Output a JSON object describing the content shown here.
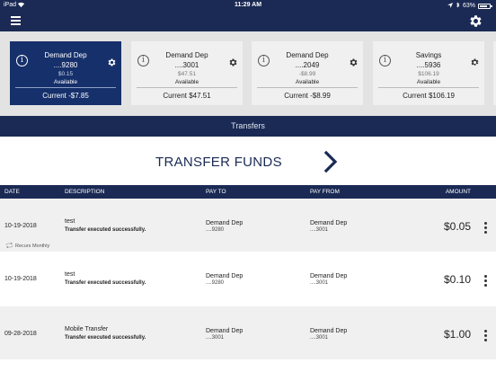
{
  "status_bar": {
    "carrier": "iPad",
    "time": "11:29 AM",
    "battery": "63%",
    "battery_level": 0.63
  },
  "accounts": [
    {
      "title": "Demand Dep",
      "number": "....9280",
      "balance": "$0.15",
      "available_label": "Available",
      "current": "Current -$7.85",
      "selected": true
    },
    {
      "title": "Demand Dep",
      "number": "....3001",
      "balance": "$47.51",
      "available_label": "Available",
      "current": "Current $47.51",
      "selected": false
    },
    {
      "title": "Demand Dep",
      "number": "....2049",
      "balance": "-$8.99",
      "available_label": "Available",
      "current": "Current -$8.99",
      "selected": false
    },
    {
      "title": "Savings",
      "number": "....5936",
      "balance": "$106.19",
      "available_label": "Available",
      "current": "Current $106.19",
      "selected": false
    }
  ],
  "section_title": "Transfers",
  "transfer_funds_label": "TRANSFER FUNDS",
  "table": {
    "headers": {
      "date": "DATE",
      "description": "DESCRIPTION",
      "pay_to": "PAY TO",
      "pay_from": "PAY FROM",
      "amount": "AMOUNT"
    },
    "rows": [
      {
        "date": "10-19-2018",
        "description": "test",
        "status": "Transfer executed successfully.",
        "pay_to": "Demand Dep",
        "pay_to_num": "....9280",
        "pay_from": "Demand Dep",
        "pay_from_num": "....3001",
        "amount": "$0.05",
        "recurs": "Recurs Monthly"
      },
      {
        "date": "10-19-2018",
        "description": "test",
        "status": "Transfer executed successfully.",
        "pay_to": "Demand Dep",
        "pay_to_num": "....9280",
        "pay_from": "Demand Dep",
        "pay_from_num": "....3001",
        "amount": "$0.10",
        "recurs": ""
      },
      {
        "date": "09-28-2018",
        "description": "Mobile Transfer",
        "status": "Transfer executed successfully.",
        "pay_to": "Demand Dep",
        "pay_to_num": "....3001",
        "pay_from": "Demand Dep",
        "pay_from_num": "....3001",
        "amount": "$1.00",
        "recurs": ""
      }
    ]
  },
  "colors": {
    "navy": "#1a2a54",
    "selected_card": "#16306b",
    "card_bg": "#f0f0f0"
  },
  "icons": {
    "menu": "hamburger-icon",
    "settings": "gear-icon",
    "info": "info-icon",
    "next": "chevron-right-icon",
    "more": "more-vertical-icon",
    "recur": "repeat-icon"
  }
}
